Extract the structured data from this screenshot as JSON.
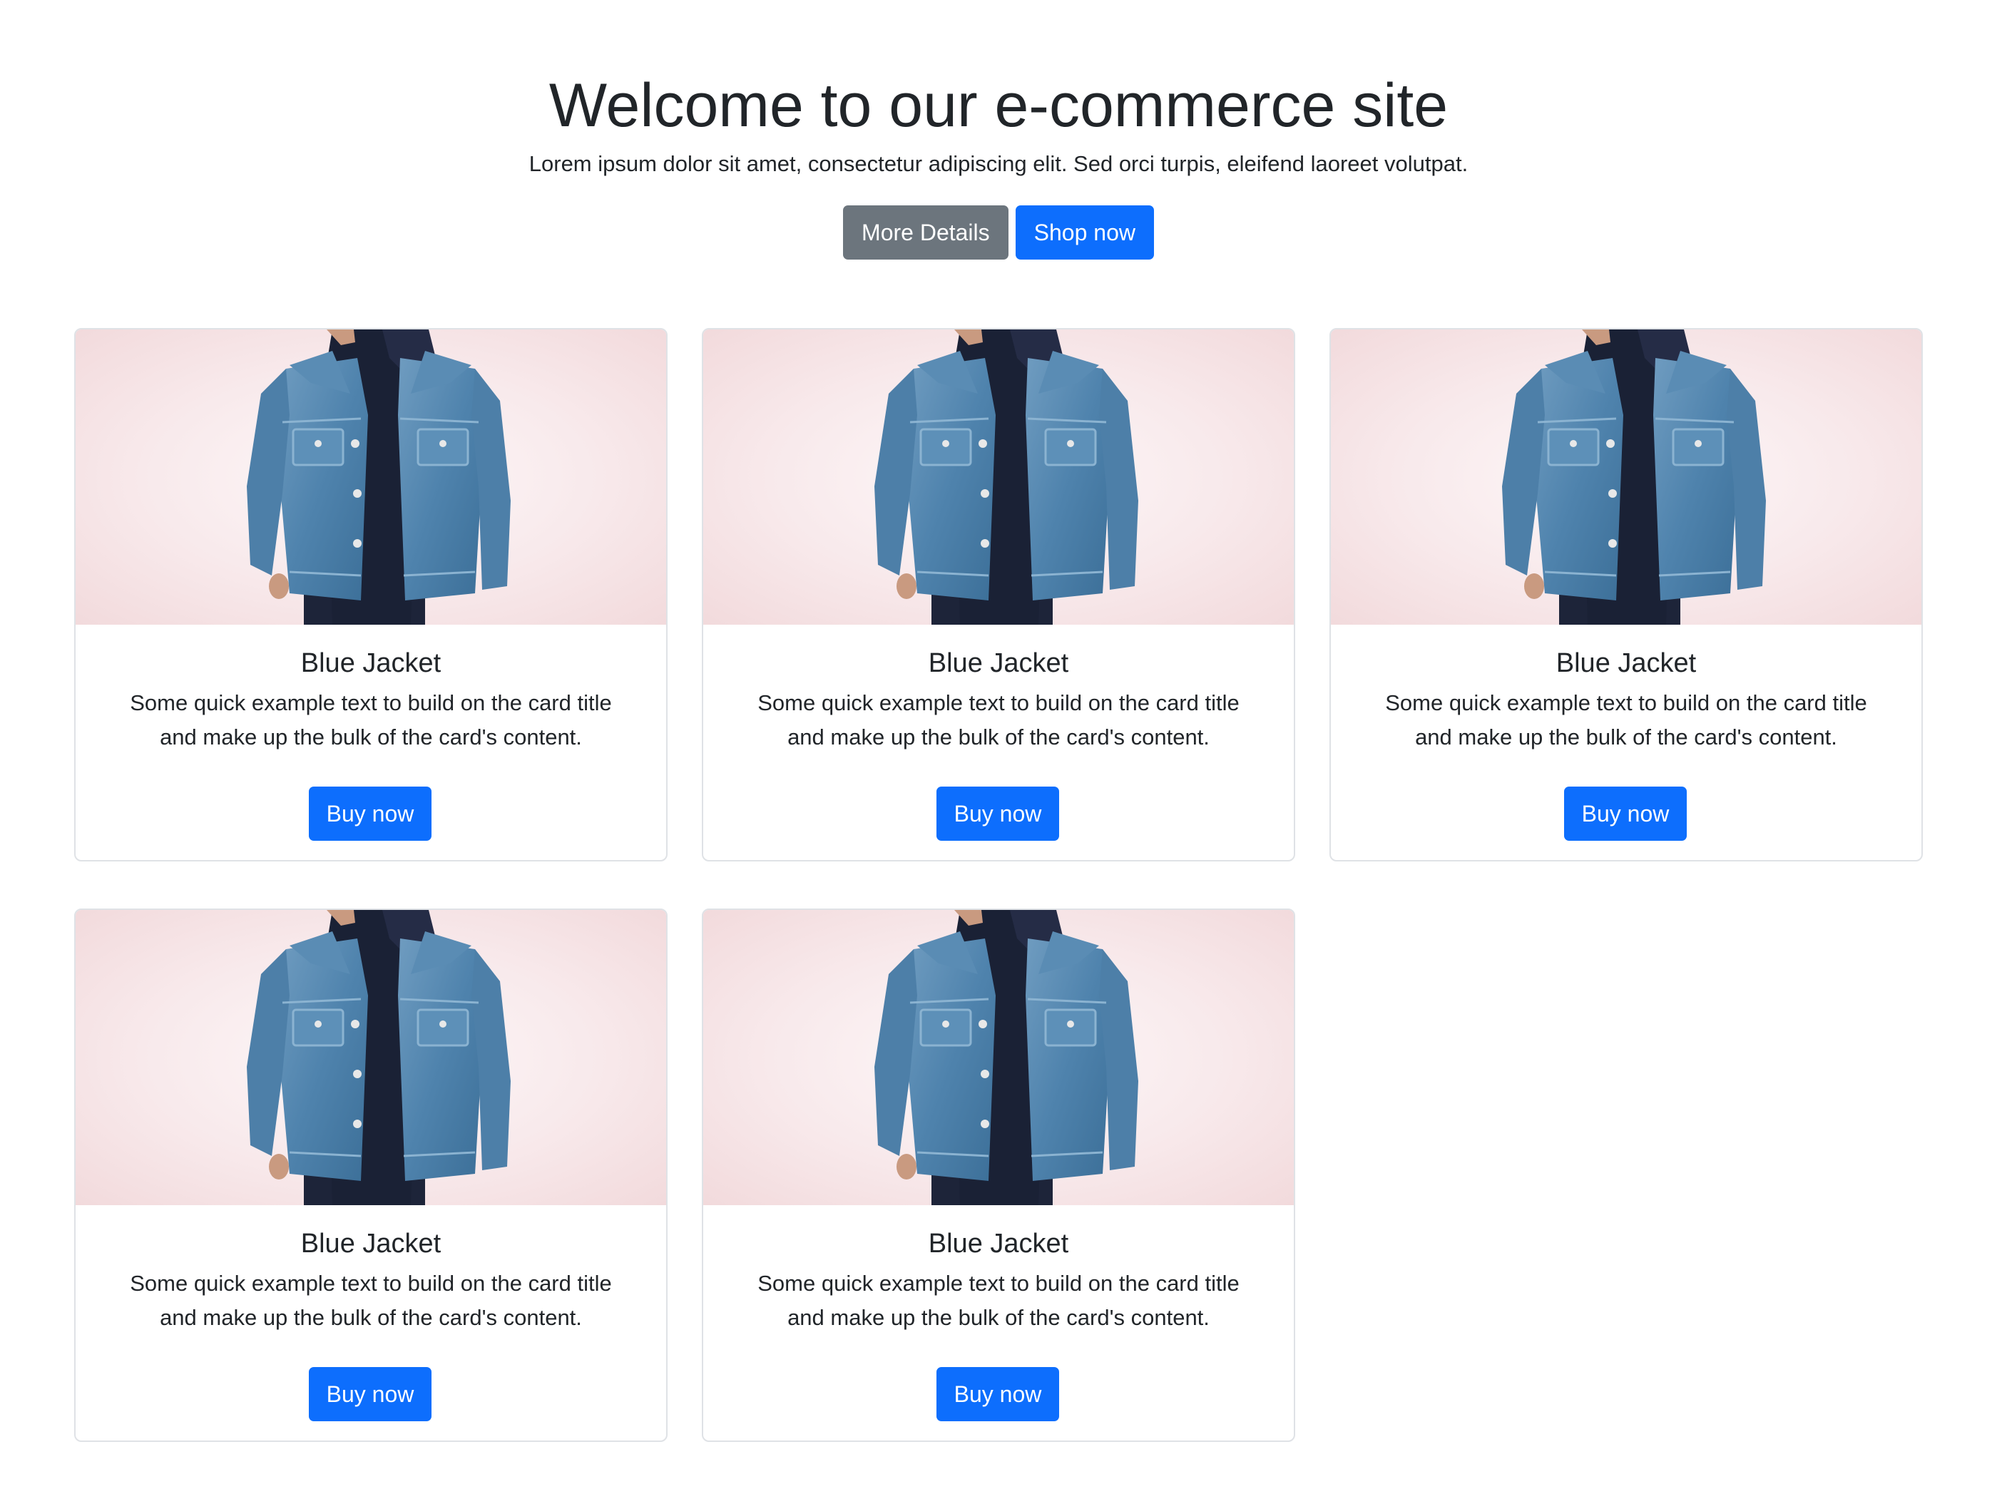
{
  "hero": {
    "title": "Welcome to our e-commerce site",
    "subtitle": "Lorem ipsum dolor sit amet, consectetur adipiscing elit. Sed orci turpis, eleifend laoreet volutpat.",
    "more_details_label": "More Details",
    "shop_now_label": "Shop now"
  },
  "colors": {
    "primary": "#0d6efd",
    "secondary": "#6c757d",
    "text": "#212529",
    "image_background": "#f5e2e4"
  },
  "products": [
    {
      "title": "Blue Jacket",
      "text": "Some quick example text to build on the card title and make up the bulk of the card's content.",
      "button": "Buy now",
      "image_icon": "denim-jacket-photo"
    },
    {
      "title": "Blue Jacket",
      "text": "Some quick example text to build on the card title and make up the bulk of the card's content.",
      "button": "Buy now",
      "image_icon": "denim-jacket-photo"
    },
    {
      "title": "Blue Jacket",
      "text": "Some quick example text to build on the card title and make up the bulk of the card's content.",
      "button": "Buy now",
      "image_icon": "denim-jacket-photo"
    },
    {
      "title": "Blue Jacket",
      "text": "Some quick example text to build on the card title and make up the bulk of the card's content.",
      "button": "Buy now",
      "image_icon": "denim-jacket-photo"
    },
    {
      "title": "Blue Jacket",
      "text": "Some quick example text to build on the card title and make up the bulk of the card's content.",
      "button": "Buy now",
      "image_icon": "denim-jacket-photo"
    }
  ]
}
